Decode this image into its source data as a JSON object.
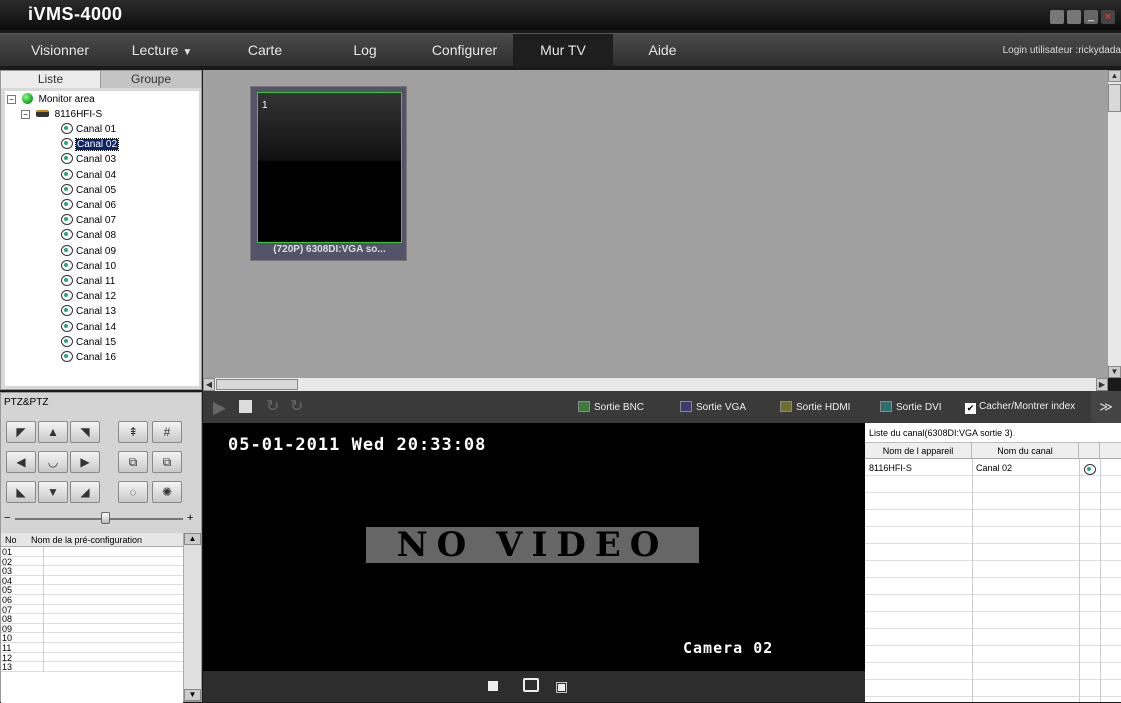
{
  "app": {
    "title": "iVMS-4000"
  },
  "menu": {
    "items": [
      {
        "label": "Visionner"
      },
      {
        "label": "Lecture"
      },
      {
        "label": "Carte"
      },
      {
        "label": "Log"
      },
      {
        "label": "Configurer"
      },
      {
        "label": "Mur TV"
      },
      {
        "label": "Aide"
      }
    ],
    "login": "Login utilisateur :rickydada"
  },
  "left_panel": {
    "tabs": [
      {
        "label": "Liste"
      },
      {
        "label": "Groupe"
      }
    ],
    "tree": {
      "root": "Monitor area",
      "device": "8116HFI-S",
      "channels": [
        "Canal 01",
        "Canal 02",
        "Canal 03",
        "Canal 04",
        "Canal 05",
        "Canal 06",
        "Canal 07",
        "Canal 08",
        "Canal 09",
        "Canal 10",
        "Canal 11",
        "Canal 12",
        "Canal 13",
        "Canal 14",
        "Canal 15",
        "Canal 16"
      ],
      "selected": "Canal 02"
    }
  },
  "ptz": {
    "title": "PTZ&PTZ",
    "slider_minus": "−",
    "slider_plus": "+",
    "preset_headers": {
      "no": "No",
      "name": "Nom de la pré-configuration"
    },
    "presets": [
      "01",
      "02",
      "03",
      "04",
      "05",
      "06",
      "07",
      "08",
      "09",
      "10",
      "11",
      "12",
      "13"
    ]
  },
  "wall": {
    "monitor_index": "1",
    "monitor_label": "(720P) 6308DI:VGA so..."
  },
  "toolbar": {
    "outputs": [
      {
        "label": "Sortie BNC",
        "color": "#3e7a3e"
      },
      {
        "label": "Sortie VGA",
        "color": "#3d3a6e"
      },
      {
        "label": "Sortie HDMI",
        "color": "#6e6e2e"
      },
      {
        "label": "Sortie DVI",
        "color": "#2e6e6e"
      }
    ],
    "toggle_label": "Cacher/Montrer index",
    "toggle_checked": true
  },
  "video": {
    "timestamp": "05-01-2011 Wed 20:33:08",
    "no_video": "NO VIDEO",
    "camera": "Camera 02"
  },
  "channel_list": {
    "title": "Liste du canal(6308DI:VGA sortie 3)",
    "headers": {
      "device": "Nom de l appareil",
      "channel": "Nom du canal"
    },
    "rows": [
      {
        "device": "8116HFI-S",
        "channel": "Canal 02"
      }
    ]
  }
}
